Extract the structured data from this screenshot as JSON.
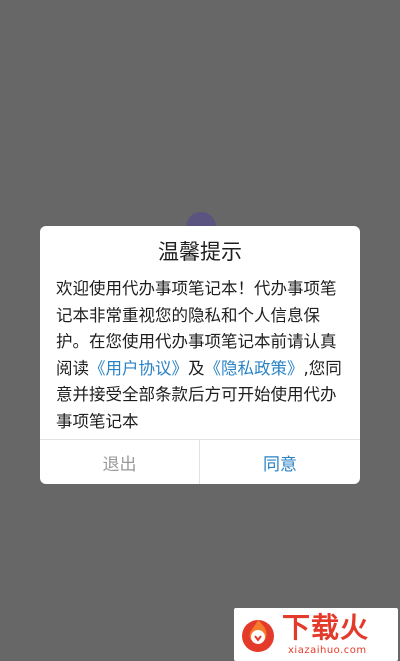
{
  "dialog": {
    "title": "温馨提示",
    "text_1": "欢迎使用代办事项笔记本！代办事项笔记本非常重视您的隐私和个人信息保护。在您使用代办事项笔记本前请认真阅读",
    "link_user_agreement": "《用户协议》",
    "text_2": "及",
    "link_privacy_policy": "《隐私政策》",
    "text_3": ",您同意并接受全部条款后方可开始使用代办事项笔记本",
    "exit_label": "退出",
    "agree_label": "同意"
  },
  "watermark": {
    "brand": "下载火",
    "url": "xiazaihuo.com"
  },
  "colors": {
    "overlay": "#676767",
    "link": "#2a83c7",
    "exit_text": "#9a9a9a",
    "watermark": "#e43a2a"
  },
  "icons": {
    "watermark_logo": "flame-icon"
  }
}
